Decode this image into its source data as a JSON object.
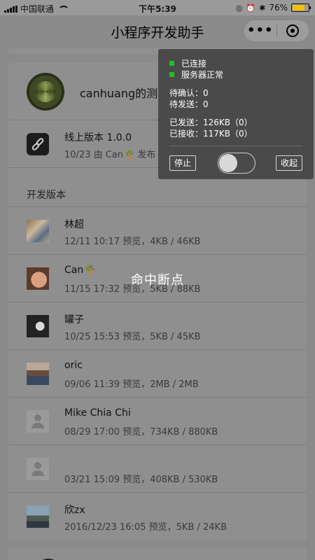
{
  "status_bar": {
    "carrier": "中国联通",
    "time": "下午5:39",
    "battery": "76%",
    "battery_level": 0.76,
    "icons": [
      "signal-icon",
      "wifi-icon",
      "lock-rotation-icon",
      "alarm-icon",
      "bluetooth-icon",
      "battery-icon"
    ]
  },
  "nav": {
    "title": "小程序开发助手",
    "more_label": "•••",
    "close_icon": "target-circle-icon"
  },
  "app": {
    "name": "canhuang的测试小程"
  },
  "online_version": {
    "label": "线上版本 1.0.0",
    "meta": "10/23 由 Can🌴 发布"
  },
  "dev_section": {
    "title": "开发版本",
    "items": [
      {
        "name": "林超",
        "meta": "12/11 10:17 预览，4KB / 46KB"
      },
      {
        "name": "Can🌴",
        "meta": "11/15 17:32 预览，5KB / 88KB"
      },
      {
        "name": "罐子",
        "meta": "10/25 15:53 预览，5KB / 45KB"
      },
      {
        "name": "oric",
        "meta": "09/06 11:39 预览，2MB / 2MB"
      },
      {
        "name": "Mike Chia Chi",
        "meta": "08/29 17:00 预览，734KB / 880KB"
      },
      {
        "name": "",
        "meta": "03/21 15:09 预览，408KB / 530KB"
      },
      {
        "name": "欣zx",
        "meta": "2016/12/23 16:05 预览，5KB / 24KB"
      }
    ]
  },
  "breakpoint_text": "命中断点",
  "debug_panel": {
    "connected": "已连接",
    "server_ok": "服务器正常",
    "pending_confirm": "待确认：0",
    "pending_send": "待发送：0",
    "sent": "已发送：126KB（0）",
    "received": "已接收：117KB（0）",
    "stop_label": "停止",
    "collapse_label": "收起",
    "status_color": "#1ec21e"
  }
}
